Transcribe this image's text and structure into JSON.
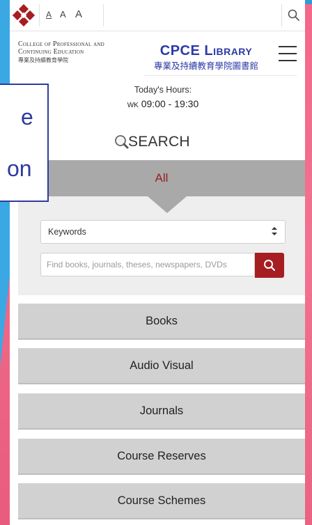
{
  "topbar": {
    "font_size_options": [
      "A",
      "A",
      "A"
    ]
  },
  "header": {
    "college_line1": "College of Professional and",
    "college_line2": "Continuing Education",
    "college_line3": "專業及持續教育學院",
    "library_title": "CPCE Library",
    "library_subtitle": "專業及持續教育學院圖書館"
  },
  "hours": {
    "label": "Today's Hours:",
    "day": "wk",
    "time": "09:00 - 19:30"
  },
  "search": {
    "title": "SEARCH",
    "tab_label": "All",
    "field_select_value": "Keywords",
    "query_placeholder": "Find books, journals, theses, newspapers, DVDs"
  },
  "categories": [
    "Books",
    "Audio Visual",
    "Journals",
    "Course Reserves",
    "Course Schemes"
  ],
  "overlay": {
    "line1": "e",
    "line2": "on"
  },
  "colors": {
    "accent_red": "#a61e22",
    "library_blue": "#2b3aa7",
    "tab_gray": "#a9a9a9"
  }
}
